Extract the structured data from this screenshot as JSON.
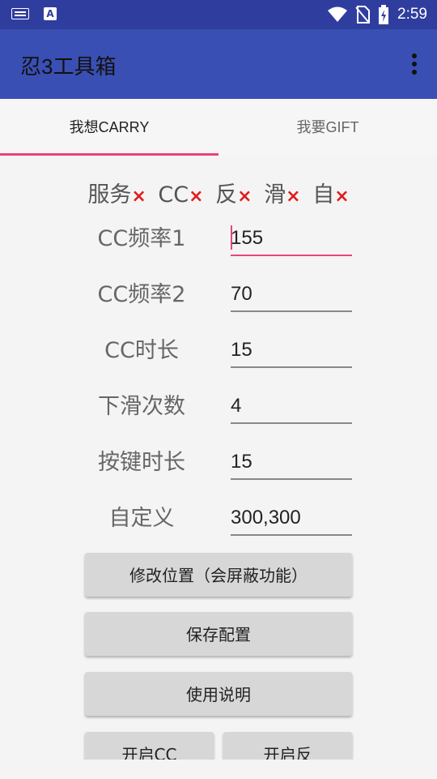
{
  "statusbar": {
    "time": "2:59",
    "icons": [
      "keyboard-icon",
      "a-icon",
      "wifi-icon",
      "no-sim-icon",
      "battery-charging-icon"
    ]
  },
  "toolbar": {
    "title": "忍3工具箱",
    "menu_icon": "more-vert-icon"
  },
  "tabs": [
    {
      "label": "我想CARRY",
      "active": true
    },
    {
      "label": "我要GIFT",
      "active": false
    }
  ],
  "status": {
    "items": [
      {
        "label": "服务",
        "mark": "×"
      },
      {
        "label": "CC",
        "mark": "×"
      },
      {
        "label": "反",
        "mark": "×"
      },
      {
        "label": "滑",
        "mark": "×"
      },
      {
        "label": "自",
        "mark": "×"
      }
    ]
  },
  "form": {
    "rows": [
      {
        "label": "CC频率1",
        "value": "155"
      },
      {
        "label": "CC频率2",
        "value": "70"
      },
      {
        "label": "CC时长",
        "value": "15"
      },
      {
        "label": "下滑次数",
        "value": "4"
      },
      {
        "label": "按键时长",
        "value": "15"
      },
      {
        "label": "自定义",
        "value": "300,300"
      }
    ]
  },
  "buttons": {
    "modify_position": "修改位置（会屏蔽功能）",
    "save_config": "保存配置",
    "instructions": "使用说明",
    "start_cc": "开启CC",
    "start_reverse": "开启反"
  },
  "colors": {
    "accent": "#e6457a",
    "primary": "#3a4fb3",
    "primary_dark": "#2f3e9e",
    "error_mark": "#e21b1b"
  }
}
